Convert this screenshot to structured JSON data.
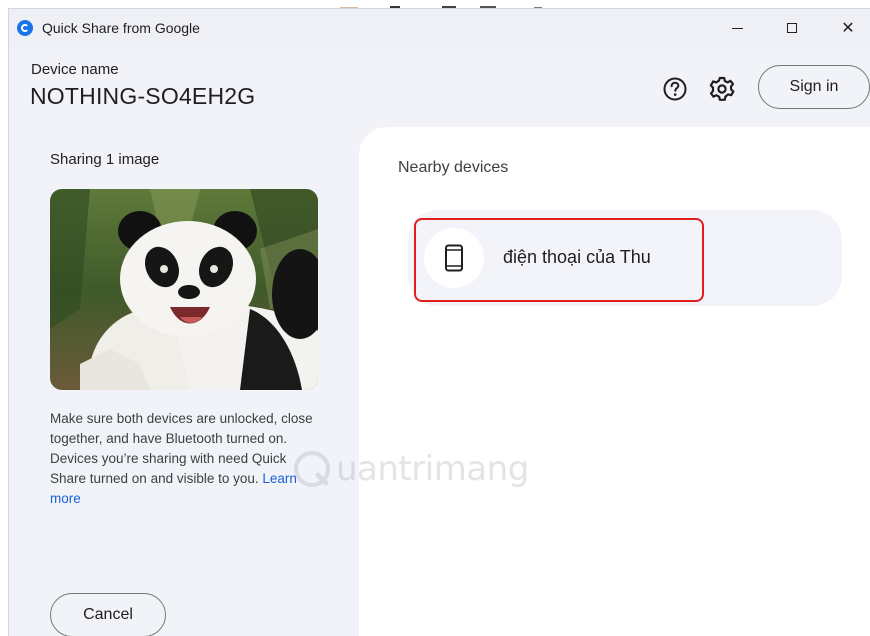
{
  "window": {
    "title": "Quick Share from Google",
    "controls": {
      "minimize_icon": "minimize-icon",
      "maximize_icon": "maximize-icon",
      "close_glyph": "✕"
    }
  },
  "header": {
    "device_label": "Device name",
    "device_name": "NOTHING-SO4EH2G",
    "sign_in_label": "Sign in",
    "help_icon": "help-circle-icon",
    "settings_icon": "gear-icon"
  },
  "left_panel": {
    "sharing_title": "Sharing 1 image",
    "preview_alt": "panda-image",
    "help_text": "Make sure both devices are unlocked, close together, and have Bluetooth turned on. Devices you’re sharing with need Quick Share turned on and visible to you.",
    "learn_more_label": "Learn more",
    "cancel_label": "Cancel"
  },
  "right_panel": {
    "nearby_title": "Nearby devices",
    "devices": [
      {
        "name": "điện thoại của Thu",
        "icon": "smartphone-icon"
      }
    ]
  },
  "watermark": {
    "text": "uantrimang"
  },
  "colors": {
    "accent": "#1a73e8",
    "link": "#1a60d6",
    "highlight_border": "#e01e1e",
    "panel_bg": "#f1f3f9"
  }
}
